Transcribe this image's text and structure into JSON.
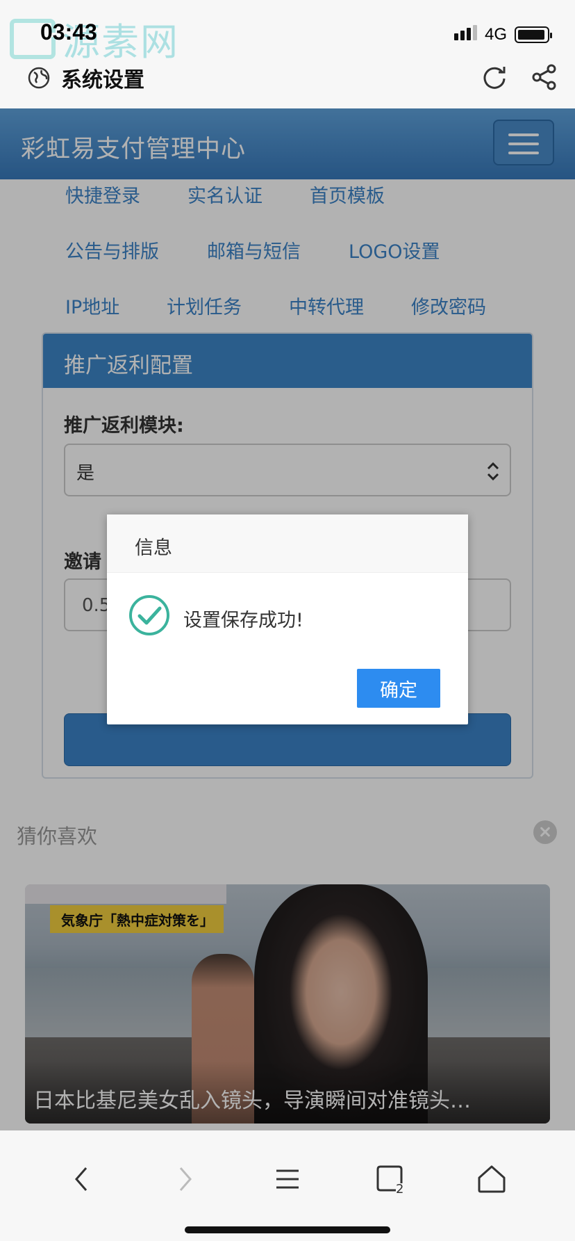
{
  "watermark": {
    "text": "源素网"
  },
  "status_bar": {
    "time": "03:43",
    "network": "4G"
  },
  "browser": {
    "title": "系统设置",
    "icons": [
      "globe-icon",
      "refresh-icon",
      "share-icon"
    ]
  },
  "header": {
    "brand": "彩虹易支付管理中心",
    "menu_icon": "hamburger-icon"
  },
  "nav_links": {
    "row1": [
      "快捷登录",
      "实名认证",
      "首页模板"
    ],
    "row2": [
      "公告与排版",
      "邮箱与短信",
      "LOGO设置"
    ],
    "row3": [
      "IP地址",
      "计划任务",
      "中转代理",
      "修改密码"
    ]
  },
  "panel": {
    "title": "推广返利配置",
    "module_label": "推广返利模块:",
    "module_value": "是",
    "invite_label_visible": "邀请",
    "invite_value_visible": "0.5"
  },
  "recommend": {
    "label": "猜你喜欢",
    "close_icon": "close-circle-icon",
    "tv_caption": "気象庁「熱中症対策を」",
    "card_title": "日本比基尼美女乱入镜头，导演瞬间对准镜头…"
  },
  "dialog": {
    "title": "信息",
    "icon": "success-check-icon",
    "message": "设置保存成功!",
    "confirm": "确定"
  },
  "bottom_bar": {
    "icons": [
      "back-icon",
      "forward-icon",
      "menu-icon",
      "tabs-icon",
      "home-icon"
    ],
    "tabs_count": "2"
  },
  "colors": {
    "brand_blue": "#3d86c8",
    "link_blue": "#3b83c8",
    "dialog_button": "#2d8cf0",
    "success_teal": "#3bb39d"
  }
}
